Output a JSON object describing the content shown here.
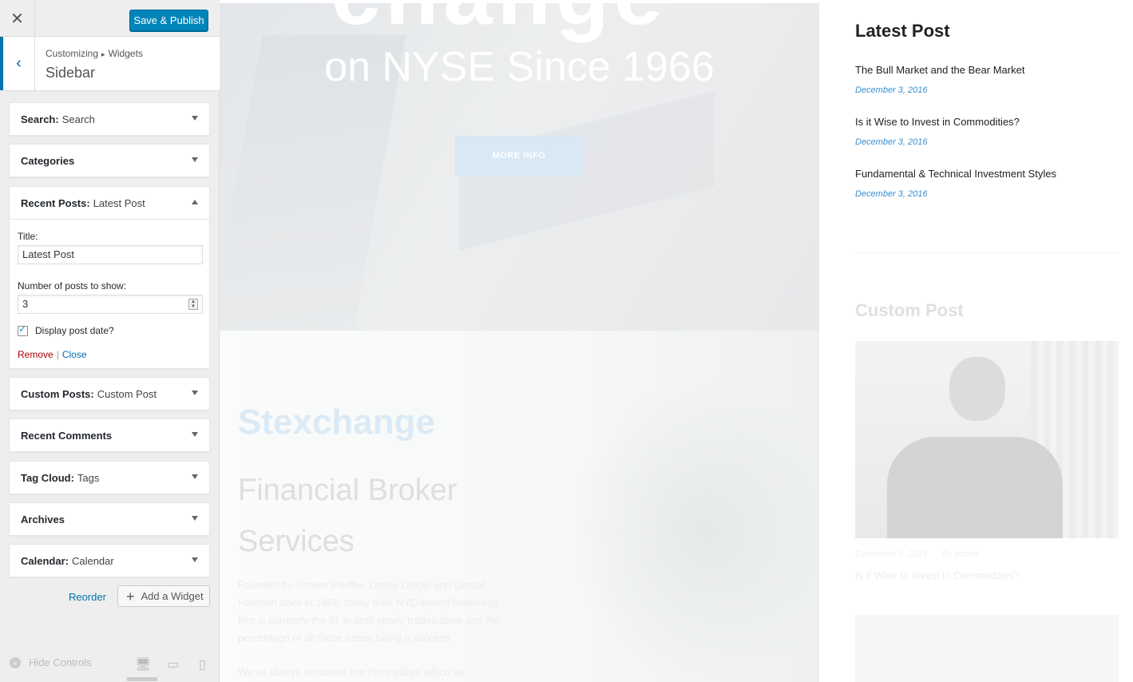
{
  "topbar": {
    "close_glyph": "✕",
    "save_label": "Save & Publish"
  },
  "section": {
    "back_glyph": "‹",
    "crumb_parent": "Customizing",
    "crumb_arrow": "▸",
    "crumb_current": "Widgets",
    "title": "Sidebar"
  },
  "widgets": [
    {
      "name": "Search:",
      "sub": "Search"
    },
    {
      "name": "Categories",
      "sub": ""
    },
    {
      "name": "Recent Posts:",
      "sub": "Latest Post"
    },
    {
      "name": "Custom Posts:",
      "sub": "Custom Post"
    },
    {
      "name": "Recent Comments",
      "sub": ""
    },
    {
      "name": "Tag Cloud:",
      "sub": "Tags"
    },
    {
      "name": "Archives",
      "sub": ""
    },
    {
      "name": "Calendar:",
      "sub": "Calendar"
    }
  ],
  "recent_form": {
    "title_label": "Title:",
    "title_value": "Latest Post",
    "number_label": "Number of posts to show:",
    "number_value": "3",
    "display_date_label": "Display post date?",
    "display_date_checked": true,
    "remove_label": "Remove",
    "separator": "|",
    "close_label": "Close"
  },
  "actions": {
    "reorder_label": "Reorder",
    "add_widget_label": "Add a Widget",
    "add_icon": "+"
  },
  "footer": {
    "hide_controls_label": "Hide Controls",
    "hide_icon": "«",
    "desktop_icon": "🖥",
    "tablet_icon": "▭",
    "mobile_icon": "▯"
  },
  "preview": {
    "hero_big": "change",
    "hero_subtitle": "on NYSE Since 1966",
    "more_info_label": "MORE INFO",
    "brand": "Stexchange",
    "about_heading_1": "Financial Broker",
    "about_heading_2": "Services",
    "about_text": "Founded by Steven Pfeiffer, Lesley Dingle and Gerald Harrison back in 1966, today their NYC-based brokerage firm is currently the #1 in both yearly trades done and the percentage of all those cases being a success.",
    "about_text_2": "We've always remained the three pillars which we",
    "latest_title": "Latest Post",
    "latest_posts": [
      {
        "title": "The Bull Market and the Bear Market",
        "date": "December 3, 2016"
      },
      {
        "title": "Is it Wise to Invest in Commodities?",
        "date": "December 3, 2016"
      },
      {
        "title": "Fundamental & Technical Investment Styles",
        "date": "December 3, 2016"
      }
    ],
    "custom_title": "Custom Post",
    "custom_meta_date": "December 3, 2016",
    "custom_meta_author": "By admin",
    "custom_post_title": "Is it Wise to Invest in Commodities?"
  },
  "colors": {
    "accent": "#0073aa",
    "primary_button": "#0085ba",
    "remove": "#aa0000",
    "post_date": "#3a8fd0"
  }
}
